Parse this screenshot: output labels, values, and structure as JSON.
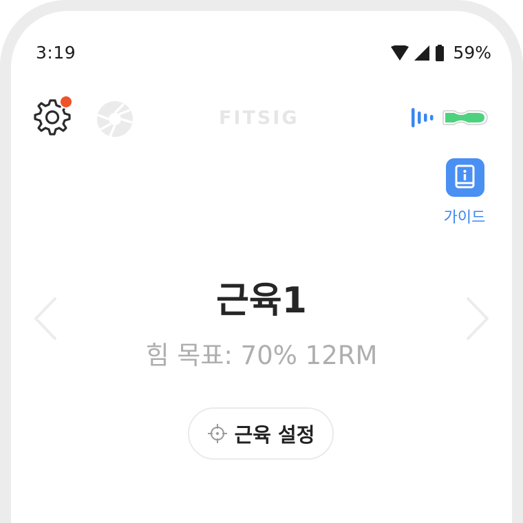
{
  "status_bar": {
    "time": "3:19",
    "battery_percent": "59%",
    "icons": [
      "wifi-icon",
      "cellular-signal-icon",
      "battery-icon"
    ]
  },
  "header": {
    "brand": "FITSIG",
    "settings_icon": "gear-icon",
    "settings_badge_color": "#f0522b",
    "shutter_icon": "camera-shutter-icon",
    "device_icons": [
      "signal-bars-icon",
      "muscle-sensor-icon"
    ],
    "signal_color": "#3a86f0",
    "sensor_color": "#4fd27f"
  },
  "guide": {
    "icon": "book-info-icon",
    "label": "가이드",
    "color": "#4a8ff2"
  },
  "main": {
    "title": "근육1",
    "goal": "힘 목표: 70% 12RM",
    "prev_icon": "chevron-left-icon",
    "next_icon": "chevron-right-icon"
  },
  "muscle_setting": {
    "icon": "crosshair-icon",
    "label": "근육 설정"
  }
}
